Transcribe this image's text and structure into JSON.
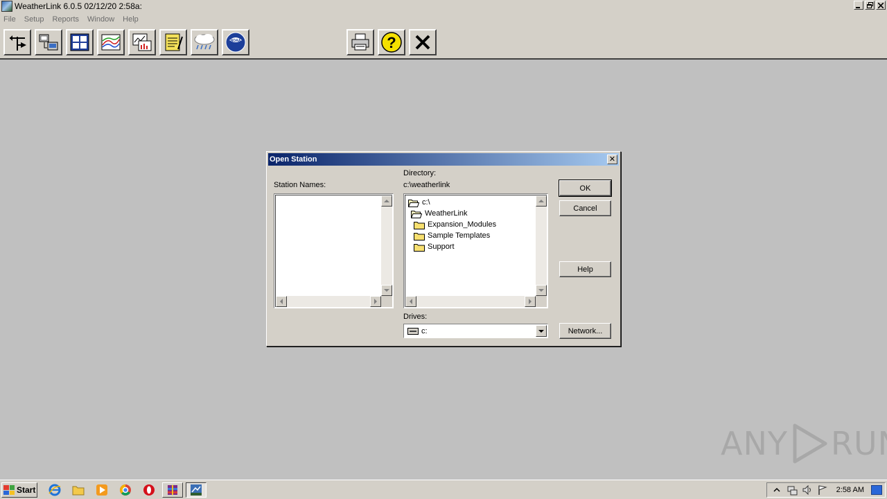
{
  "window": {
    "title": "WeatherLink 6.0.5  02/12/20  2:58a:",
    "controls": [
      "minimize",
      "restore",
      "close"
    ]
  },
  "menu": {
    "items": [
      {
        "label": "File"
      },
      {
        "label": "Setup"
      },
      {
        "label": "Reports"
      },
      {
        "label": "Window"
      },
      {
        "label": "Help"
      }
    ]
  },
  "toolbar": {
    "buttons": [
      {
        "icon": "weather-station-icon"
      },
      {
        "icon": "download-icon"
      },
      {
        "icon": "bulletin-icon"
      },
      {
        "icon": "graph-icon"
      },
      {
        "icon": "browse-icon"
      },
      {
        "icon": "notepad-icon"
      },
      {
        "icon": "rain-cloud-icon"
      },
      {
        "icon": "noaa-icon"
      },
      {
        "icon": "printer-icon"
      },
      {
        "icon": "help-icon"
      },
      {
        "icon": "exit-icon"
      }
    ]
  },
  "dialog": {
    "title": "Open Station",
    "close_symbol": "✕",
    "station_names_label": "Station Names:",
    "station_names": [],
    "directory_label": "Directory:",
    "directory_path": "c:\\weatherlink",
    "directory_tree": [
      {
        "label": "c:\\",
        "state": "open"
      },
      {
        "label": "WeatherLink",
        "state": "open"
      },
      {
        "label": "Expansion_Modules",
        "state": "closed"
      },
      {
        "label": "Sample Templates",
        "state": "closed"
      },
      {
        "label": "Support",
        "state": "closed"
      }
    ],
    "drives_label": "Drives:",
    "drive_value": "c:",
    "buttons": {
      "ok": "OK",
      "cancel": "Cancel",
      "help": "Help",
      "network": "Network..."
    }
  },
  "watermark": {
    "text_left": "ANY",
    "text_right": "RUN"
  },
  "taskbar": {
    "start_label": "Start",
    "clock": "2:58 AM",
    "quick_launch": [
      "internet-explorer-icon",
      "folder-icon",
      "media-player-icon",
      "chrome-icon",
      "opera-icon"
    ],
    "tasks": [
      "winrar-icon",
      "weatherlink-icon"
    ],
    "tray": [
      "expand-tray-icon",
      "network-icon",
      "volume-icon",
      "flag-icon"
    ]
  }
}
